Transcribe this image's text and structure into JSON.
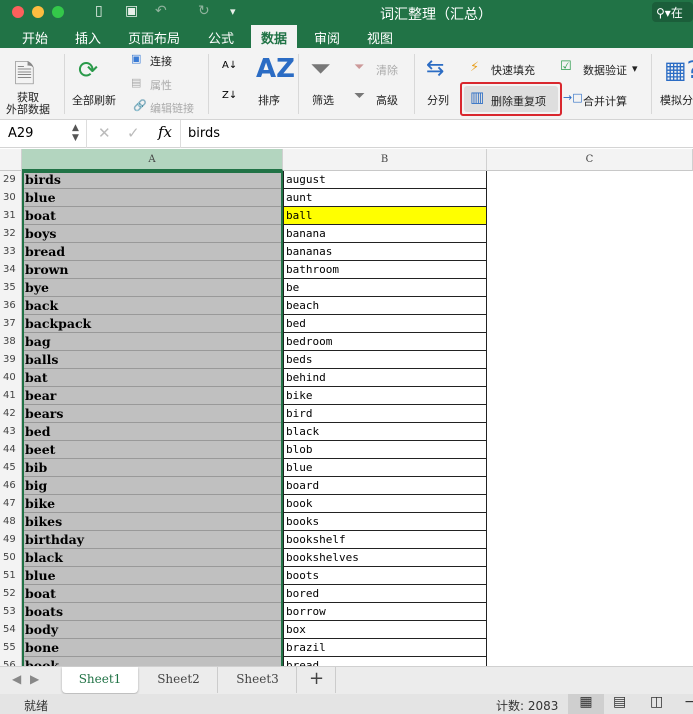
{
  "window": {
    "title": "词汇整理（汇总）",
    "search_placeholder": "在"
  },
  "tabs": [
    "开始",
    "插入",
    "页面布局",
    "公式",
    "数据",
    "审阅",
    "视图"
  ],
  "active_tab": "数据",
  "ribbon": {
    "get_external": "获取\n外部数据",
    "get_external_1": "获取",
    "get_external_2": "外部数据",
    "refresh_all": "全部刷新",
    "connections": "连接",
    "properties": "属性",
    "edit_links": "编辑链接",
    "sort": "排序",
    "filter": "筛选",
    "clear": "清除",
    "advanced": "高级",
    "text_to_columns": "分列",
    "flash_fill": "快速填充",
    "remove_duplicates": "删除重复项",
    "data_validation": "数据验证",
    "consolidate": "合并计算",
    "what_if": "模拟分析"
  },
  "formula_bar": {
    "name_box": "A29",
    "fx": "fx",
    "value": "birds"
  },
  "columns": [
    "A",
    "B",
    "C"
  ],
  "rows": [
    {
      "n": "29",
      "a": "birds",
      "b": "august"
    },
    {
      "n": "30",
      "a": "blue",
      "b": "aunt"
    },
    {
      "n": "31",
      "a": "boat",
      "b": "ball",
      "highlight": "#ffff00"
    },
    {
      "n": "32",
      "a": "boys",
      "b": "banana"
    },
    {
      "n": "33",
      "a": "bread",
      "b": "bananas"
    },
    {
      "n": "34",
      "a": "brown",
      "b": "bathroom"
    },
    {
      "n": "35",
      "a": "bye",
      "b": "be"
    },
    {
      "n": "36",
      "a": "back",
      "b": "beach"
    },
    {
      "n": "37",
      "a": "backpack",
      "b": "bed"
    },
    {
      "n": "38",
      "a": "bag",
      "b": "bedroom"
    },
    {
      "n": "39",
      "a": "balls",
      "b": "beds"
    },
    {
      "n": "40",
      "a": "bat",
      "b": "behind"
    },
    {
      "n": "41",
      "a": "bear",
      "b": "bike"
    },
    {
      "n": "42",
      "a": "bears",
      "b": "bird"
    },
    {
      "n": "43",
      "a": "bed",
      "b": "black"
    },
    {
      "n": "44",
      "a": "beet",
      "b": "blob"
    },
    {
      "n": "45",
      "a": "bib",
      "b": "blue"
    },
    {
      "n": "46",
      "a": "big",
      "b": "board"
    },
    {
      "n": "47",
      "a": "bike",
      "b": "book"
    },
    {
      "n": "48",
      "a": "bikes",
      "b": "books"
    },
    {
      "n": "49",
      "a": "birthday",
      "b": "bookshelf"
    },
    {
      "n": "50",
      "a": "black",
      "b": "bookshelves"
    },
    {
      "n": "51",
      "a": "blue",
      "b": "boots"
    },
    {
      "n": "52",
      "a": "boat",
      "b": "bored"
    },
    {
      "n": "53",
      "a": "boats",
      "b": "borrow"
    },
    {
      "n": "54",
      "a": "body",
      "b": "box"
    },
    {
      "n": "55",
      "a": "bone",
      "b": "brazil"
    },
    {
      "n": "56",
      "a": "book",
      "b": "bread"
    }
  ],
  "sheets": [
    "Sheet1",
    "Sheet2",
    "Sheet3"
  ],
  "add_sheet": "+",
  "status": {
    "ready": "就绪",
    "count": "计数: 2083"
  },
  "colors": {
    "brand": "#217346",
    "highlight": "#ffff00",
    "outline": "#d9272e"
  }
}
